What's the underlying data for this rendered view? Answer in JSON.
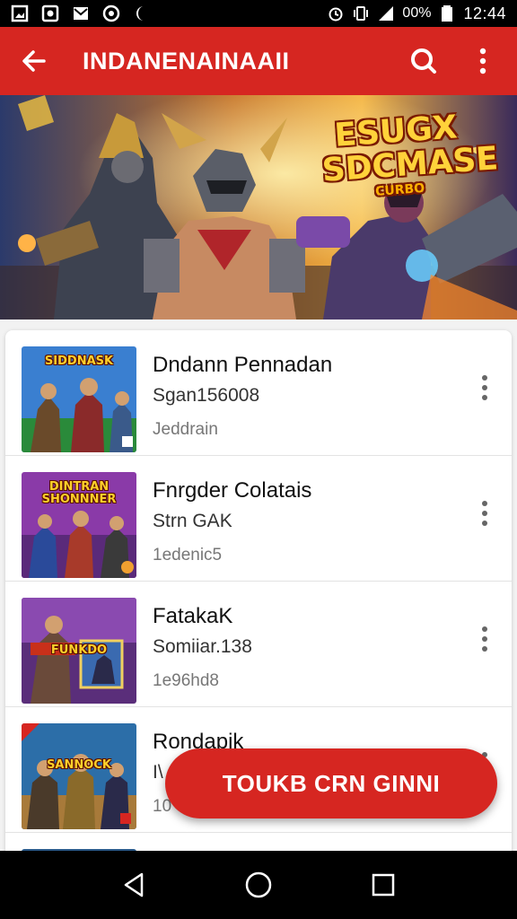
{
  "status_bar": {
    "left_icons": [
      "image-icon",
      "record-icon",
      "mail-icon",
      "circle-dot-icon",
      "moon-icon"
    ],
    "battery": "00%",
    "time": "12:44"
  },
  "app_bar": {
    "title": "INDANENAINAAII"
  },
  "banner": {
    "logo_main": "ESUGX SDCMASE",
    "logo_sub": "CURBO"
  },
  "list": {
    "items": [
      {
        "title": "Dndann Pennadan",
        "subtitle": "Sgan156008",
        "meta": "Jeddrain",
        "thumb_caption": "SIDDNASK",
        "thumb_color": "#2a8a3a"
      },
      {
        "title": "Fnrgder Colatais",
        "subtitle": "Strn GAK",
        "meta": "1edenic5",
        "thumb_caption": "DINTRAN SHONNNER",
        "thumb_color": "#8a3aa8"
      },
      {
        "title": "FatakaK",
        "subtitle": "Somiiar.138",
        "meta": "1e96hd8",
        "thumb_caption": "FUNKDO",
        "thumb_color": "#5a2e7a"
      },
      {
        "title": "Rondapik",
        "subtitle": "I\\",
        "meta": "10",
        "thumb_caption": "SANNOCK",
        "thumb_color": "#2c6ea8"
      }
    ]
  },
  "fab": {
    "label": "TOUKB CRN GINNI"
  },
  "colors": {
    "primary": "#d62621",
    "status_bar": "#000000",
    "nav_bar": "#000000"
  }
}
